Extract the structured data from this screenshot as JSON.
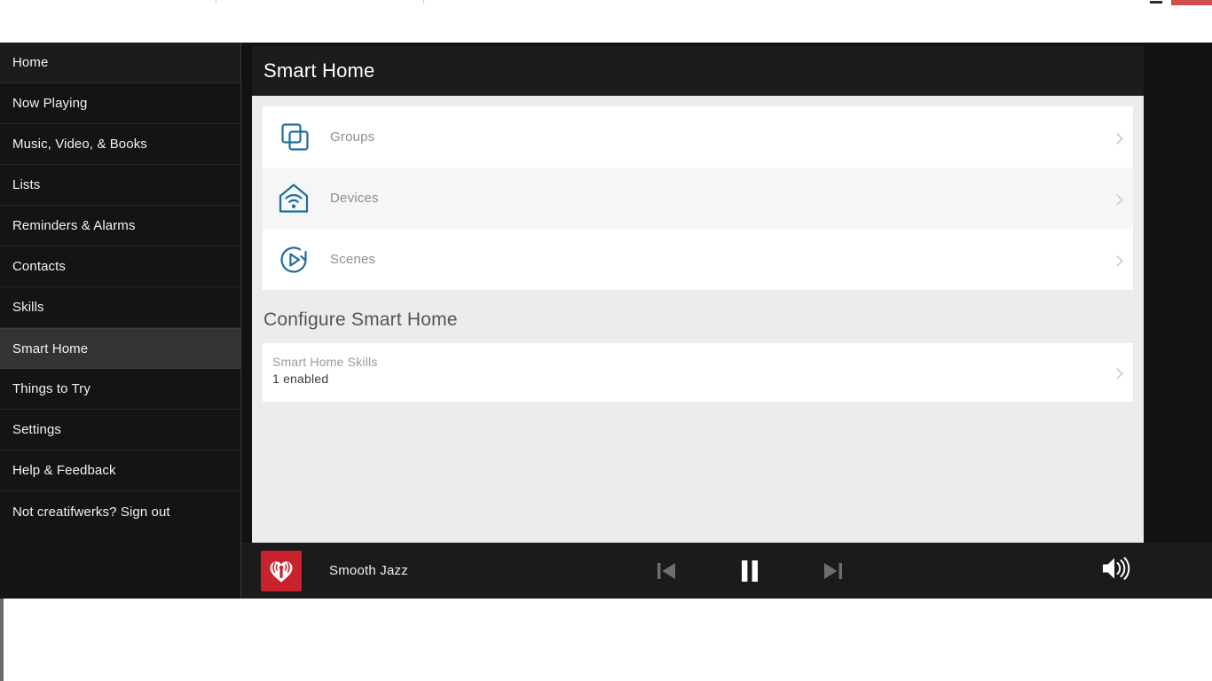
{
  "window": {
    "minimize_label": "minimize",
    "close_label": "close",
    "tab_label": ""
  },
  "sidebar": {
    "items": [
      {
        "label": "Home",
        "state": "first"
      },
      {
        "label": "Now Playing",
        "state": "normal"
      },
      {
        "label": "Music, Video, & Books",
        "state": "normal"
      },
      {
        "label": "Lists",
        "state": "normal"
      },
      {
        "label": "Reminders & Alarms",
        "state": "normal"
      },
      {
        "label": "Contacts",
        "state": "normal"
      },
      {
        "label": "Skills",
        "state": "normal"
      },
      {
        "label": "Smart Home",
        "state": "active"
      },
      {
        "label": "Things to Try",
        "state": "normal"
      },
      {
        "label": "Settings",
        "state": "normal"
      },
      {
        "label": "Help & Feedback",
        "state": "normal"
      },
      {
        "label": "Not creatifwerks? Sign out",
        "state": "normal"
      }
    ]
  },
  "header": {
    "title": "Smart Home"
  },
  "main": {
    "rows": [
      {
        "label": "Groups",
        "icon": "groups-icon",
        "chevron": "chevron-right-icon"
      },
      {
        "label": "Devices",
        "icon": "devices-icon",
        "chevron": "chevron-right-icon"
      },
      {
        "label": "Scenes",
        "icon": "scenes-icon",
        "chevron": "chevron-right-icon"
      }
    ],
    "section_title": "Configure Smart Home",
    "skills_row": {
      "title": "Smart Home Skills",
      "subtitle": "1 enabled",
      "chevron": "chevron-right-icon"
    }
  },
  "player": {
    "artwork_icon": "iheartradio-logo-icon",
    "track_title": "Smooth Jazz",
    "previous_icon": "skip-previous-icon",
    "pause_icon": "pause-icon",
    "next_icon": "skip-next-icon",
    "volume_icon": "volume-high-icon"
  },
  "colors": {
    "sidebar_bg": "#141414",
    "sidebar_active": "#333333",
    "header_bg": "#1c1c1c",
    "content_bg": "#ececec",
    "row_bg": "#ffffff",
    "row_alt_bg": "#f6f6f6",
    "icon_blue": "#1d6f9e",
    "brand_red": "#c8232c",
    "player_bg": "#1b1b1b",
    "close_red": "#cf4d4d"
  }
}
